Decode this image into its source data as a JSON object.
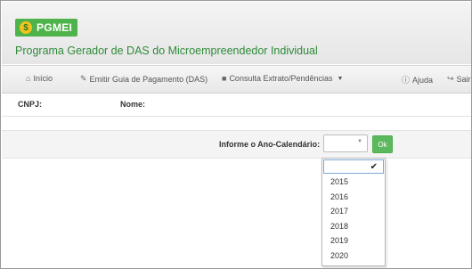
{
  "app": {
    "logo_text": "PGMEI",
    "logo_mark": "$",
    "title": "Programa Gerador de DAS do Microempreendedor Individual"
  },
  "nav": {
    "items": [
      {
        "icon": "home-icon",
        "label": "Início"
      },
      {
        "icon": "edit-icon",
        "label": "Emitir Guia de Pagamento (DAS)"
      },
      {
        "icon": "lock-icon",
        "label": "Consulta Extrato/Pendências"
      }
    ],
    "help_label": "Ajuda",
    "exit_label": "Sair"
  },
  "info": {
    "cnpj_label": "CNPJ:",
    "name_label": "Nome:"
  },
  "year_selector": {
    "label": "Informe o Ano-Calendário:",
    "selected_value": "",
    "ok_label": "Ok",
    "options": [
      "2015",
      "2016",
      "2017",
      "2018",
      "2019",
      "2020"
    ]
  },
  "colors": {
    "brand_green": "#4eb34a",
    "title_green": "#2f8a3a",
    "ok_button": "#5cb85c"
  }
}
